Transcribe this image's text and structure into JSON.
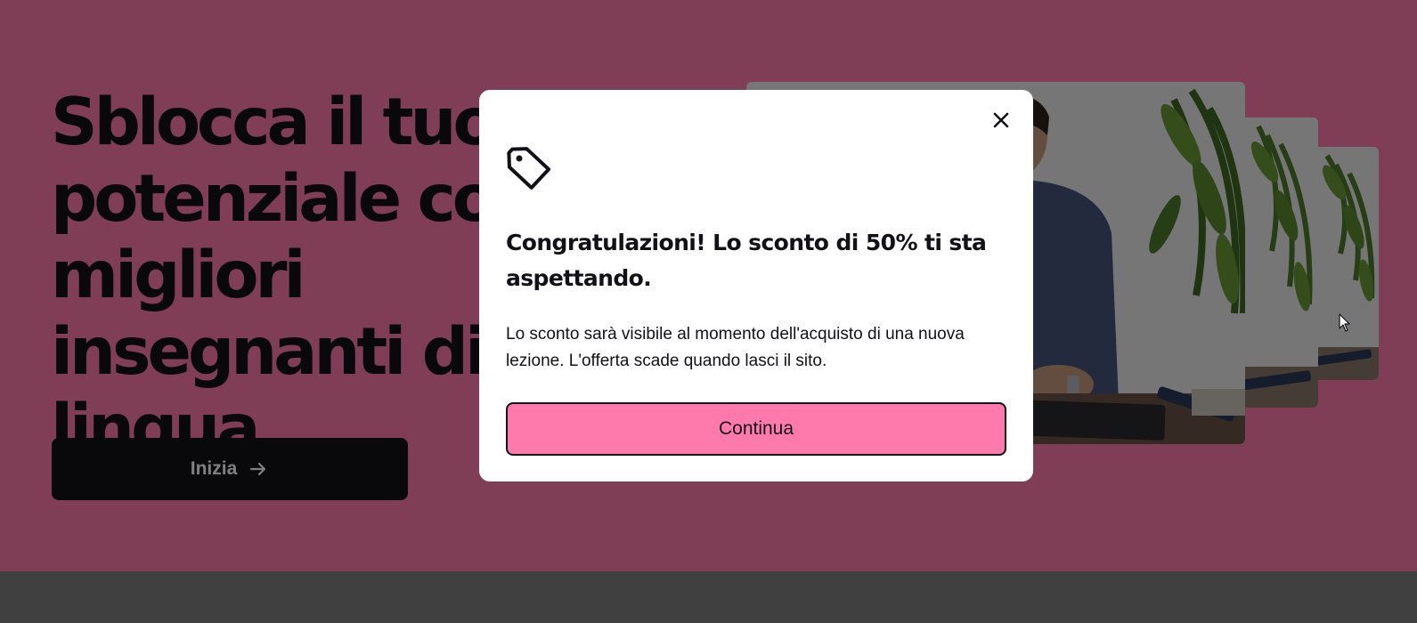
{
  "colors": {
    "hero_background": "#ff7aac",
    "page_bottom": "#808080",
    "dark": "#121117",
    "accent_pink": "#ff7aac",
    "modal_background": "#ffffff"
  },
  "hero": {
    "title": "Sblocca il tuo potenziale con i migliori insegnanti di lingua.",
    "cta_label": "Inizia",
    "cta_icon": "arrow-right-icon"
  },
  "photos": {
    "alt": "insegnante"
  },
  "modal": {
    "close_icon": "close-icon",
    "tag_icon": "price-tag-icon",
    "title": "Congratulazioni! Lo sconto di 50% ti sta aspettando.",
    "body": "Lo sconto sarà visibile al momento dell'acquisto di una nuova lezione. L'offerta scade quando lasci il sito.",
    "continue_label": "Continua"
  }
}
